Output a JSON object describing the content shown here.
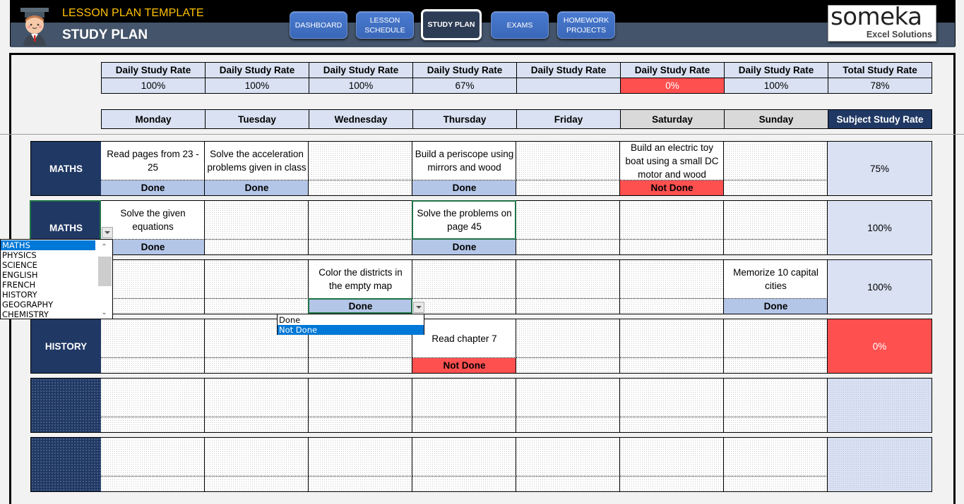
{
  "header": {
    "template_title": "LESSON PLAN TEMPLATE",
    "page_title": "STUDY PLAN",
    "nav": [
      {
        "label": "DASHBOARD",
        "active": false
      },
      {
        "label": "LESSON SCHEDULE",
        "active": false
      },
      {
        "label": "STUDY PLAN",
        "active": true
      },
      {
        "label": "EXAMS",
        "active": false
      },
      {
        "label": "HOMEWORK PROJECTS",
        "active": false
      }
    ],
    "logo": {
      "brand": "someka",
      "tagline": "Excel Solutions"
    }
  },
  "daily_rates": {
    "headers": [
      "Daily Study Rate",
      "Daily Study Rate",
      "Daily Study Rate",
      "Daily Study Rate",
      "Daily Study Rate",
      "Daily Study Rate",
      "Daily Study Rate",
      "Total Study Rate"
    ],
    "values": [
      "100%",
      "100%",
      "100%",
      "67%",
      "",
      "0%",
      "100%",
      "78%"
    ]
  },
  "days": [
    "Monday",
    "Tuesday",
    "Wednesday",
    "Thursday",
    "Friday",
    "Saturday",
    "Sunday"
  ],
  "subject_rate_header": "Subject Study Rate",
  "rows": [
    {
      "subject": "MATHS",
      "rate": "75%",
      "tasks": [
        "Read pages from 23 - 25",
        "Solve the acceleration problems given in class",
        "",
        "Build a periscope using mirrors and wood",
        "",
        "Build an electric toy boat using a small DC motor and wood",
        ""
      ],
      "status": [
        "Done",
        "Done",
        "",
        "Done",
        "",
        "Not Done",
        ""
      ]
    },
    {
      "subject": "MATHS",
      "rate": "100%",
      "tasks": [
        "Solve the given equations",
        "",
        "",
        "Solve the problems on page 45",
        "",
        "",
        ""
      ],
      "status": [
        "Done",
        "",
        "",
        "Done",
        "",
        "",
        ""
      ]
    },
    {
      "subject": "",
      "rate": "100%",
      "tasks": [
        "",
        "",
        "Color the districts in the empty map",
        "",
        "",
        "",
        "Memorize 10 capital cities"
      ],
      "status": [
        "",
        "",
        "Done",
        "",
        "",
        "",
        "Done"
      ]
    },
    {
      "subject": "HISTORY",
      "rate": "0%",
      "tasks": [
        "",
        "",
        "",
        "Read chapter 7",
        "",
        "",
        ""
      ],
      "status": [
        "",
        "",
        "",
        "Not Done",
        "",
        "",
        ""
      ]
    },
    {
      "subject": "",
      "rate": "",
      "tasks": [
        "",
        "",
        "",
        "",
        "",
        "",
        ""
      ],
      "status": [
        "",
        "",
        "",
        "",
        "",
        "",
        ""
      ]
    },
    {
      "subject": "",
      "rate": "",
      "tasks": [
        "",
        "",
        "",
        "",
        "",
        "",
        ""
      ],
      "status": [
        "",
        "",
        "",
        "",
        "",
        "",
        ""
      ]
    }
  ],
  "subject_dropdown": {
    "options": [
      "MATHS",
      "PHYSICS",
      "SCIENCE",
      "ENGLISH",
      "FRENCH",
      "HISTORY",
      "GEOGRAPHY",
      "CHEMISTRY"
    ],
    "highlighted": "MATHS"
  },
  "status_dropdown": {
    "options": [
      "Done",
      "Not Done"
    ],
    "highlighted": "Not Done"
  },
  "colors": {
    "navy": "#203864",
    "header_blue": "#d9e1f2",
    "done_blue": "#b4c6e7",
    "not_done_red": "#ff5050",
    "accent_yellow": "#ffc000"
  }
}
